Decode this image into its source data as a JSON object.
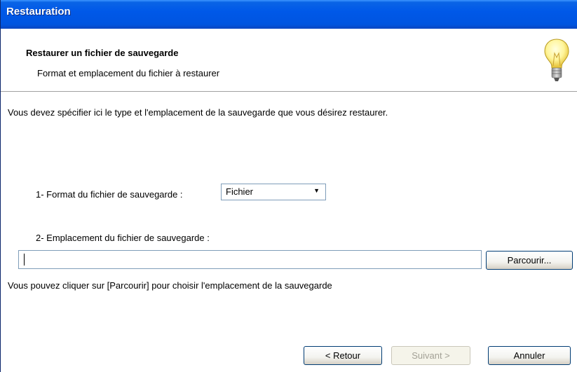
{
  "window": {
    "title": "Restauration"
  },
  "header": {
    "title": "Restaurer un fichier de sauvegarde",
    "subtitle": "Format et emplacement du fichier à restaurer",
    "icon": "lightbulb-icon"
  },
  "main": {
    "intro": "Vous devez spécifier ici le type et l'emplacement de la sauvegarde que vous désirez restaurer.",
    "format_label": "1- Format du fichier de sauvegarde :",
    "format_value": "Fichier",
    "location_label": "2- Emplacement du fichier de sauvegarde :",
    "location_value": "",
    "browse_label": "Parcourir...",
    "hint": "Vous pouvez cliquer sur [Parcourir] pour choisir l'emplacement de la sauvegarde"
  },
  "footer": {
    "back_label": "< Retour",
    "next_label": "Suivant >",
    "cancel_label": "Annuler"
  },
  "colors": {
    "titlebar": "#0058e8",
    "title_text": "#ffffff",
    "disabled_text": "#a3a196"
  }
}
